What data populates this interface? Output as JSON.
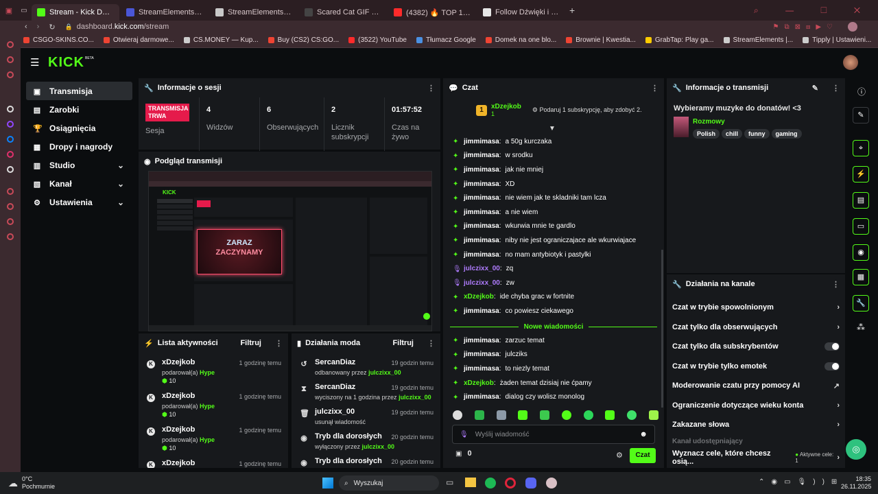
{
  "browser": {
    "tabs": [
      {
        "title": "Stream - Kick Dashboard",
        "color": "#53fc18",
        "active": true
      },
      {
        "title": "StreamElements - Overla",
        "color": "#4a56d6"
      },
      {
        "title": "StreamElements - julczix",
        "color": "#c9c9c9"
      },
      {
        "title": "Scared Cat GIF by KETNI",
        "color": "#444"
      },
      {
        "title": "(4382) 🔥 TOP 15 PIOSE",
        "color": "#ff2b2b"
      },
      {
        "title": "Follow Dźwięki i Efekty D",
        "color": "#e6e6e6"
      }
    ],
    "url_prefix": "dashboard.",
    "url_domain": "kick.com",
    "url_path": "/stream",
    "bookmarks": [
      {
        "label": "CSGO-SKINS.CO...",
        "color": "#e43"
      },
      {
        "label": "Otwieraj darmowe...",
        "color": "#e43"
      },
      {
        "label": "CS.MONEY — Kup...",
        "color": "#ccc"
      },
      {
        "label": "Buy (CS2) CS:GO...",
        "color": "#e43"
      },
      {
        "label": "(3522) YouTube",
        "color": "#ff2b2b"
      },
      {
        "label": "Tłumacz Google",
        "color": "#4a90e2"
      },
      {
        "label": "Domek na one blo...",
        "color": "#e43"
      },
      {
        "label": "Brownie | Kwestia...",
        "color": "#e43"
      },
      {
        "label": "GrabTap: Play ga...",
        "color": "#ffcc00"
      },
      {
        "label": "StreamElements |...",
        "color": "#ccc"
      },
      {
        "label": "Tipply | Ustawieni...",
        "color": "#ccc"
      }
    ]
  },
  "brand": {
    "logo": "KICK",
    "beta": "BETA"
  },
  "nav": [
    {
      "label": "Transmisja",
      "icon": "broadcast-icon",
      "glyph": "▣",
      "active": true
    },
    {
      "label": "Zarobki",
      "icon": "earnings-icon",
      "glyph": "▤"
    },
    {
      "label": "Osiągnięcia",
      "icon": "trophy-icon",
      "glyph": "🏆"
    },
    {
      "label": "Dropy i nagrody",
      "icon": "gift-icon",
      "glyph": "▦"
    },
    {
      "label": "Studio",
      "icon": "studio-icon",
      "glyph": "▥",
      "chevron": true
    },
    {
      "label": "Kanał",
      "icon": "channel-icon",
      "glyph": "▧",
      "chevron": true
    },
    {
      "label": "Ustawienia",
      "icon": "settings-icon",
      "glyph": "⚙",
      "chevron": true
    }
  ],
  "session": {
    "title": "Informacje o sesji",
    "live_badge_line1": "TRANSMISJA",
    "live_badge_line2": "TRWA",
    "live_label": "Sesja",
    "stats": [
      {
        "value": "4",
        "label": "Widzów"
      },
      {
        "value": "6",
        "label": "Obserwujących"
      },
      {
        "value": "2",
        "label": "Licznik subskrypcji"
      },
      {
        "value": "01:57:52",
        "label": "Czas na żywo"
      }
    ]
  },
  "preview": {
    "title": "Podgląd transmisji",
    "neon_line1": "ZARAZ",
    "neon_line2": "ZACZYNAMY"
  },
  "activity": {
    "title": "Lista aktywności",
    "filter": "Filtruj",
    "items": [
      {
        "name": "xDzejkob",
        "time": "1 godzinę temu",
        "desc": "podarował(a)",
        "hype": "Hype",
        "count": "10"
      },
      {
        "name": "xDzejkob",
        "time": "1 godzinę temu",
        "desc": "podarował(a)",
        "hype": "Hype",
        "count": "10"
      },
      {
        "name": "xDzejkob",
        "time": "1 godzinę temu",
        "desc": "podarował(a)",
        "hype": "Hype",
        "count": "10"
      },
      {
        "name": "xDzejkob",
        "time": "1 godzinę temu",
        "desc": "",
        "hype": "",
        "count": ""
      }
    ]
  },
  "mod": {
    "title": "Działania moda",
    "filter": "Filtruj",
    "items": [
      {
        "name": "SercanDiaz",
        "time": "19 godzin temu",
        "desc": "odbanowany przez ",
        "by": "julczixx_00",
        "icon": "undo-icon",
        "glyph": "↺"
      },
      {
        "name": "SercanDiaz",
        "time": "19 godzin temu",
        "desc": "wyciszony na 1 godzina przez ",
        "by": "julczixx_00",
        "icon": "hourglass-icon",
        "glyph": "⧗"
      },
      {
        "name": "julczixx_00",
        "time": "19 godzin temu",
        "desc": "usunął wiadomość",
        "by": "",
        "icon": "trash-icon",
        "glyph": "🗑"
      },
      {
        "name": "Tryb dla dorosłych",
        "time": "20 godzin temu",
        "desc": "wyłączony przez ",
        "by": "julczixx_00",
        "icon": "eye-icon",
        "glyph": "◉"
      },
      {
        "name": "Tryb dla dorosłych",
        "time": "20 godzin temu",
        "desc": "",
        "by": "",
        "icon": "eye-icon",
        "glyph": "◉"
      }
    ]
  },
  "chat": {
    "title": "Czat",
    "top_user": "xDzejkob",
    "top_count": "1",
    "sub_prompt": "Podaruj 1 subskrypcję, aby zdobyć 2.",
    "messages": [
      {
        "user": "jimmimasa",
        "text": "a 50g kurczaka",
        "color": "#fff",
        "badge": "green"
      },
      {
        "user": "jimmimasa",
        "text": "w srodku",
        "color": "#fff",
        "badge": "green"
      },
      {
        "user": "jimmimasa",
        "text": "jak nie mniej",
        "color": "#fff",
        "badge": "green"
      },
      {
        "user": "jimmimasa",
        "text": "XD",
        "color": "#fff",
        "badge": "green"
      },
      {
        "user": "jimmimasa",
        "text": "nie wiem jak te skladniki tam lcza",
        "color": "#fff",
        "badge": "green"
      },
      {
        "user": "jimmimasa",
        "text": "a nie wiem",
        "color": "#fff",
        "badge": "green"
      },
      {
        "user": "jimmimasa",
        "text": "wkurwia mnie te gardlo",
        "color": "#fff",
        "badge": "green"
      },
      {
        "user": "jimmimasa",
        "text": "niby nie jest ograniczajace ale wkurwiajace",
        "color": "#fff",
        "badge": "green"
      },
      {
        "user": "jimmimasa",
        "text": "no mam antybiotyk i pastylki",
        "color": "#fff",
        "badge": "green"
      },
      {
        "user": "julczixx_00",
        "text": "zq",
        "color": "#b07cff",
        "badge": "mic"
      },
      {
        "user": "julczixx_00",
        "text": "zw",
        "color": "#b07cff",
        "badge": "mic"
      },
      {
        "user": "xDzejkob",
        "text": "ide chyba grac w fortnite",
        "color": "#53fc18",
        "badge": "green"
      },
      {
        "user": "jimmimasa",
        "text": "co powiesz ciekawego",
        "color": "#fff",
        "badge": "green"
      }
    ],
    "new_messages": "Nowe wiadomości",
    "messages2": [
      {
        "user": "jimmimasa",
        "text": "zarzuc temat",
        "color": "#fff",
        "badge": "green"
      },
      {
        "user": "jimmimasa",
        "text": "julcziks",
        "color": "#fff",
        "badge": "green"
      },
      {
        "user": "jimmimasa",
        "text": "to niezly temat",
        "color": "#fff",
        "badge": "green"
      },
      {
        "user": "xDzejkob",
        "text": "żaden temat dzisiaj nie ćpamy",
        "color": "#53fc18",
        "badge": "green"
      },
      {
        "user": "jimmimasa",
        "text": "dialog czy wolisz monolog",
        "color": "#fff",
        "badge": "green"
      }
    ],
    "input_placeholder": "Wyślij wiadomość",
    "points": "0",
    "send": "Czat"
  },
  "stream_info": {
    "title": "Informacje o transmisji",
    "stream_title": "Wybieramy muzyke do donatów! <3",
    "category": "Rozmowy",
    "tags": [
      "Polish",
      "chill",
      "funny",
      "gaming"
    ]
  },
  "channel_actions": {
    "title": "Działania na kanale",
    "rows": [
      {
        "label": "Czat w trybie spowolnionym",
        "type": "chevron"
      },
      {
        "label": "Czat tylko dla obserwujących",
        "type": "chevron"
      },
      {
        "label": "Czat tylko dla subskrybentów",
        "type": "toggle"
      },
      {
        "label": "Czat w trybie tylko emotek",
        "type": "toggle"
      },
      {
        "label": "Moderowanie czatu przy pomocy AI",
        "type": "external"
      },
      {
        "label": "Ograniczenie dotyczące wieku konta",
        "type": "chevron"
      },
      {
        "label": "Zakazane słowa",
        "type": "chevron"
      }
    ],
    "section_label": "Kanał udostępniający",
    "goal_label": "Wyznacz cele, które chcesz osią...",
    "goal_status": "Aktywne cele: 1"
  },
  "taskbar": {
    "temp": "0°C",
    "weather": "Pochmurnie",
    "search": "Wyszukaj",
    "time": "18:35",
    "date": "26.11.2025"
  }
}
